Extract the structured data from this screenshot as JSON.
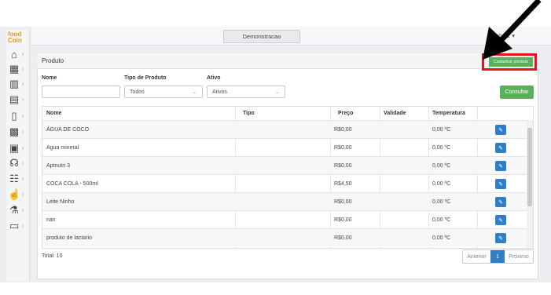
{
  "topbar": {
    "demo_label": "Demonstracao",
    "user_name": "o Schutz ▾"
  },
  "logo": {
    "line1": "food",
    "line2": "Coin"
  },
  "sidebar": {
    "items": [
      {
        "icon": "home-icon",
        "glyph": "⌂"
      },
      {
        "icon": "grid-icon",
        "glyph": "▦"
      },
      {
        "icon": "building-icon",
        "glyph": "▥"
      },
      {
        "icon": "store-icon",
        "glyph": "▤"
      },
      {
        "icon": "document-icon",
        "glyph": "▯"
      },
      {
        "icon": "report-icon",
        "glyph": "▩"
      },
      {
        "icon": "clipboard-icon",
        "glyph": "▣"
      },
      {
        "icon": "people-icon",
        "glyph": "☊"
      },
      {
        "icon": "group-icon",
        "glyph": "☷"
      },
      {
        "icon": "hand-icon",
        "glyph": "☝"
      },
      {
        "icon": "flask-icon",
        "glyph": "⚗"
      },
      {
        "icon": "monitor-icon",
        "glyph": "▭"
      }
    ]
  },
  "panel": {
    "title": "Produto",
    "add_label": "Cadastrar produto"
  },
  "filters": {
    "nome_label": "Nome",
    "tipo_label": "Tipo de Produto",
    "tipo_value": "Todos",
    "ativo_label": "Ativo",
    "ativo_value": "Ativos",
    "consultar_label": "Consultar"
  },
  "table": {
    "headers": {
      "nome": "Nome",
      "tipo": "Tipo",
      "preco": "Preço",
      "validade": "Validade",
      "temperatura": "Temperatura"
    },
    "rows": [
      {
        "nome": "ÁGUA DE COCO",
        "tipo": "",
        "preco": "R$0,00",
        "validade": "",
        "temperatura": "0,00 ºC"
      },
      {
        "nome": "Agua mineral",
        "tipo": "",
        "preco": "R$0,00",
        "validade": "",
        "temperatura": "0,00 ºC"
      },
      {
        "nome": "Aptnutri 3",
        "tipo": "",
        "preco": "R$0,00",
        "validade": "",
        "temperatura": "0,00 ºC"
      },
      {
        "nome": "COCA COLA - 500ml",
        "tipo": "",
        "preco": "R$4,50",
        "validade": "",
        "temperatura": "0,00 ºC"
      },
      {
        "nome": "Leite Ninho",
        "tipo": "",
        "preco": "R$0,00",
        "validade": "",
        "temperatura": "0,00 ºC"
      },
      {
        "nome": "nan",
        "tipo": "",
        "preco": "R$0,00",
        "validade": "",
        "temperatura": "0,00 ºC"
      },
      {
        "nome": "produto de lactario",
        "tipo": "",
        "preco": "R$0,00",
        "validade": "",
        "temperatura": "0,00 ºC"
      }
    ]
  },
  "footer": {
    "total": "Total: 10"
  },
  "pagination": {
    "prev": "Anterior",
    "current": "1",
    "next": "Próximo"
  },
  "colors": {
    "accent_green": "#58b15b",
    "accent_blue": "#2f7fc8",
    "highlight_red": "#e8141b"
  }
}
